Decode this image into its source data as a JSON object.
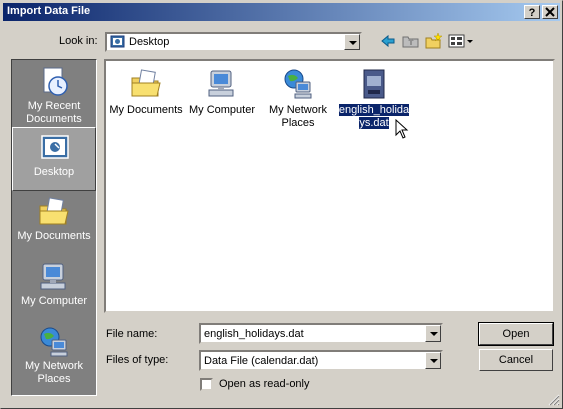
{
  "window": {
    "title": "Import Data File",
    "help_button": "?",
    "close_button": "X"
  },
  "toolbar": {
    "look_in_label": "Look in:",
    "look_in_value": "Desktop",
    "back_icon": "back-arrow-icon",
    "up_icon": "up-folder-icon",
    "new_folder_icon": "new-folder-icon",
    "views_icon": "views-menu-icon"
  },
  "places": [
    {
      "label": "My Recent Documents",
      "icon": "recent-documents-icon",
      "selected": false
    },
    {
      "label": "Desktop",
      "icon": "desktop-icon",
      "selected": true
    },
    {
      "label": "My Documents",
      "icon": "my-documents-icon",
      "selected": false
    },
    {
      "label": "My Computer",
      "icon": "my-computer-icon",
      "selected": false
    },
    {
      "label": "My Network Places",
      "icon": "my-network-places-icon",
      "selected": false
    }
  ],
  "files": [
    {
      "label": "My Documents",
      "icon": "my-documents-icon",
      "selected": false
    },
    {
      "label": "My Computer",
      "icon": "my-computer-icon",
      "selected": false
    },
    {
      "label": "My Network Places",
      "icon": "my-network-places-icon",
      "selected": false
    },
    {
      "label": "english_holidays.dat",
      "label_line1": "english_holida",
      "label_line2": "ys.dat",
      "icon": "dat-file-icon",
      "selected": true
    }
  ],
  "form": {
    "file_name_label": "File name:",
    "file_name_value": "english_holidays.dat",
    "files_of_type_label": "Files of type:",
    "files_of_type_value": "Data File (calendar.dat)",
    "open_button": "Open",
    "cancel_button": "Cancel",
    "read_only_label": "Open as read-only",
    "read_only_checked": false
  },
  "colors": {
    "title_start": "#0a246a",
    "title_end": "#a6caf0",
    "selection": "#0a246a",
    "places_bg": "#808080",
    "face": "#d4d0c8"
  }
}
